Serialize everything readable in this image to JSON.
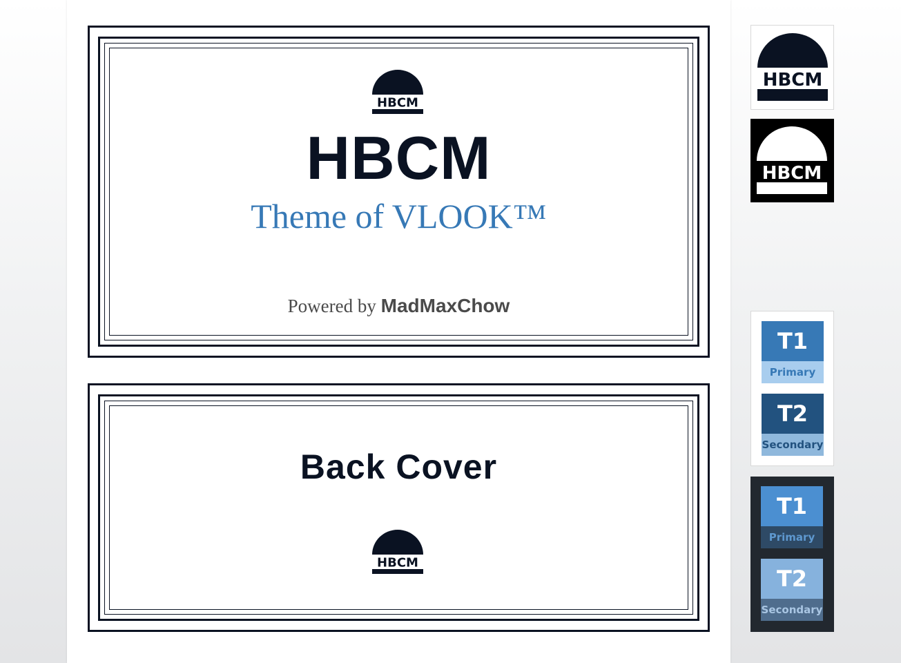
{
  "front_cover": {
    "logo_text": "HBCM",
    "title": "HBCM",
    "subtitle": "Theme of VLOOK™",
    "powered_prefix": "Powered by",
    "powered_author": "MadMaxChow"
  },
  "back_cover": {
    "title": "Back Cover",
    "logo_text": "HBCM"
  },
  "side_panel": {
    "logo_light_text": "HBCM",
    "logo_dark_text": "HBCM",
    "light_theme": [
      {
        "code": "T1",
        "label": "Primary",
        "top_color": "#3779b6",
        "bottom_color": "#a8cdee",
        "label_color": "#3779b6"
      },
      {
        "code": "T2",
        "label": "Secondary",
        "top_color": "#22527f",
        "bottom_color": "#8fb8dc",
        "label_color": "#22527f"
      }
    ],
    "dark_theme": [
      {
        "code": "T1",
        "label": "Primary",
        "top_color": "#4b8fd1",
        "bottom_color": "#2e4a66",
        "label_color": "#5e98cf"
      },
      {
        "code": "T2",
        "label": "Secondary",
        "top_color": "#86b2dd",
        "bottom_color": "#4f6d8d",
        "label_color": "#a9c6e3"
      }
    ]
  },
  "colors": {
    "navy": "#0a1222",
    "accent_blue": "#3779b6",
    "muted_text": "#4a4a4a"
  }
}
